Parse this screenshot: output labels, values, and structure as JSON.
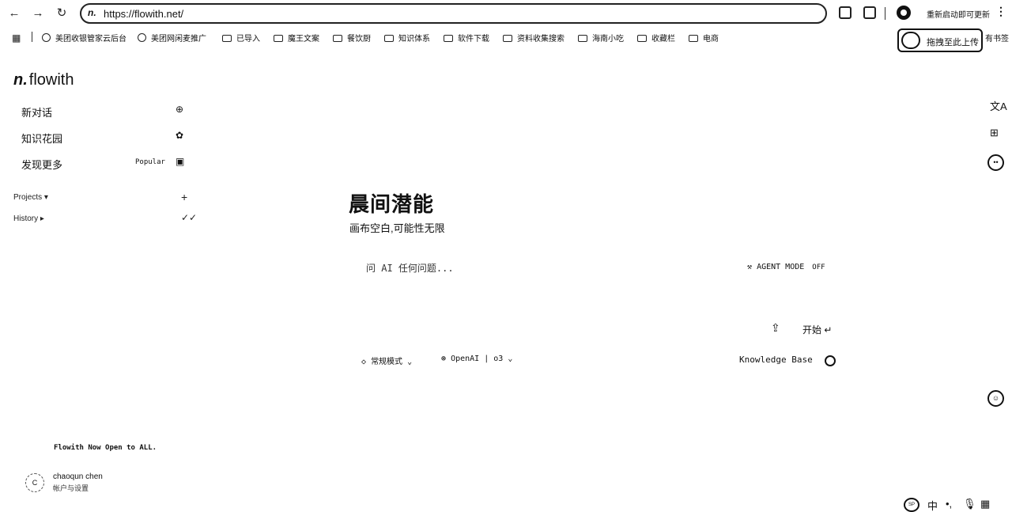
{
  "browser": {
    "url": "https://flowith.net/",
    "site_icon": "flowith-favicon",
    "restart_label": "重新启动即可更新",
    "icons": [
      "back-icon",
      "forward-icon",
      "reload-icon",
      "screenshot-icon",
      "extensions-icon",
      "profile-icon",
      "more-icon"
    ]
  },
  "bookmarks": {
    "items": [
      {
        "label": "美团收银管家云后台",
        "icon": "favicon"
      },
      {
        "label": "美团网闲麦推广",
        "icon": "favicon"
      },
      {
        "label": "已导入",
        "icon": "folder-icon"
      },
      {
        "label": "魔王文案",
        "icon": "folder-icon"
      },
      {
        "label": "餐饮厨",
        "icon": "folder-icon"
      },
      {
        "label": "知识体系",
        "icon": "folder-icon"
      },
      {
        "label": "软件下载",
        "icon": "folder-icon"
      },
      {
        "label": "资料收集搜索",
        "icon": "folder-icon"
      },
      {
        "label": "海南小吃",
        "icon": "folder-icon"
      },
      {
        "label": "收藏栏",
        "icon": "folder-icon"
      },
      {
        "label": "电商",
        "icon": "folder-icon"
      }
    ],
    "right_label": "有书签",
    "upload_float": "拖拽至此上传"
  },
  "sidebar": {
    "logo": "flowith",
    "items": [
      {
        "label": "新对话",
        "icon": "new-chat-icon"
      },
      {
        "label": "知识花园",
        "icon": "garden-icon"
      },
      {
        "label": "发现更多",
        "tag": "Popular",
        "icon": "bag-icon"
      }
    ],
    "projects_label": "Projects",
    "history_label": "History",
    "announcement": "Flowith Now Open to ALL.",
    "user": {
      "initial": "C",
      "name": "chaoqun chen",
      "sub": "帐户与设置"
    }
  },
  "main": {
    "title": "晨间潜能",
    "subtitle": "画布空白,可能性无限",
    "prompt_placeholder": "问 AI 任何问题...",
    "agent_mode_label": "AGENT MODE",
    "agent_mode_state": "OFF",
    "start_label": "开始",
    "mode_label": "常规模式",
    "model_label": "OpenAI | o3",
    "knowledge_base_label": "Knowledge Base"
  },
  "ime": {
    "lang": "中"
  }
}
